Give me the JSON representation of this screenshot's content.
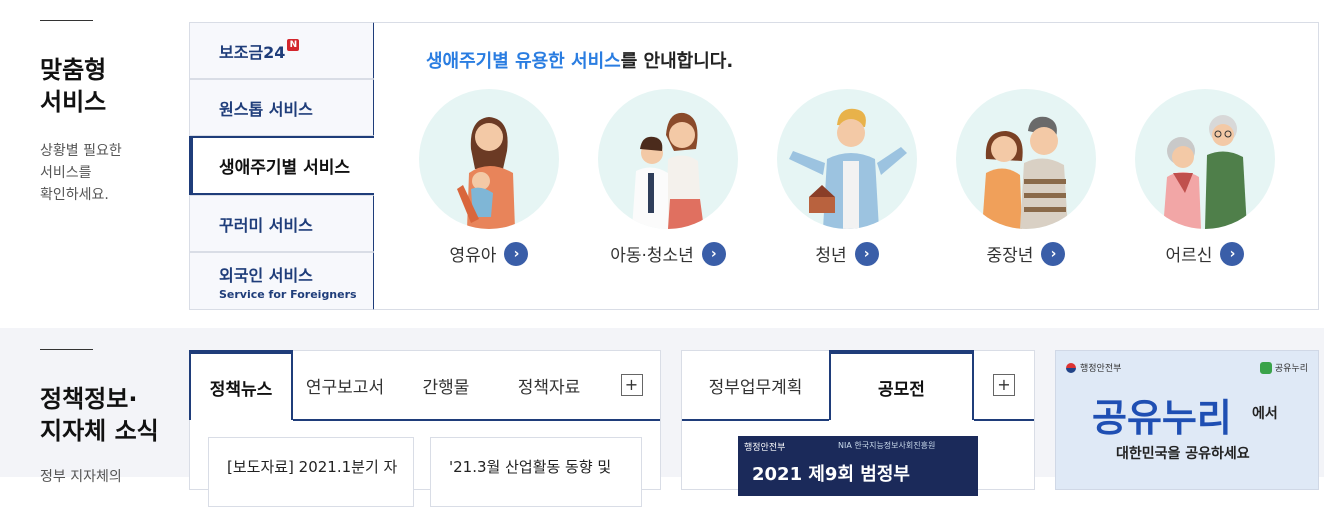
{
  "section_custom": {
    "title_line1": "맞춤형",
    "title_line2": "서비스",
    "desc_line1": "상황별 필요한",
    "desc_line2": "서비스를",
    "desc_line3": "확인하세요.",
    "tabs": [
      {
        "label": "보조금24",
        "badge": "N"
      },
      {
        "label": "원스톱 서비스"
      },
      {
        "label": "생애주기별 서비스"
      },
      {
        "label": "꾸러미 서비스"
      },
      {
        "label": "외국인 서비스",
        "sub": "Service for Foreigners"
      }
    ],
    "heading_highlight": "생애주기별 유용한 서비스",
    "heading_rest": "를 안내합니다.",
    "life_stages": [
      "영유아",
      "아동·청소년",
      "청년",
      "중장년",
      "어르신"
    ]
  },
  "section_policy": {
    "title_line1": "정책정보·",
    "title_line2": "지자체 소식",
    "desc_partial": "정부 지자체의",
    "news_tabs": [
      "정책뉴스",
      "연구보고서",
      "간행물",
      "정책자료"
    ],
    "news_items": [
      "[보도자료] 2021.1분기 자",
      "'21.3월 산업활동 동향 및"
    ],
    "plan_tabs": [
      "정부업무계획",
      "공모전"
    ],
    "banner": {
      "logo_text": "행정안전부",
      "partner_text": "NIA 한국지능정보사회진흥원",
      "title": "2021 제9회 범정부"
    },
    "promo": {
      "org": "행정안전부",
      "brand_small": "공유누리",
      "brand_big": "공유누리",
      "suffix": "에서",
      "slogan": "대한민국을 공유하세요"
    },
    "plus_symbol": "+"
  },
  "colors": {
    "navy": "#1f3d7a",
    "highlight_blue": "#2a7de1",
    "arrow_blue": "#3a5ea8",
    "circle_bg": "#e6f5f4",
    "section_bg": "#f3f4f8"
  }
}
